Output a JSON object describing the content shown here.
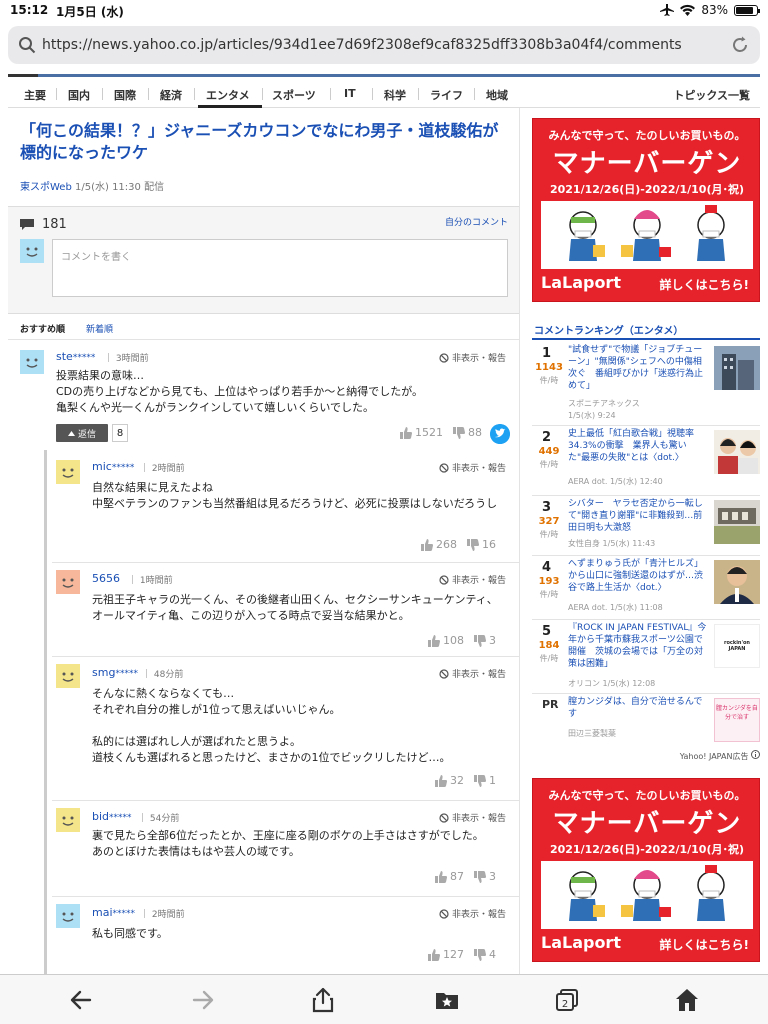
{
  "status": {
    "time": "15:12",
    "date": "1月5日 (水)",
    "battery_text": "83%",
    "battery_level": 0.83
  },
  "browser": {
    "url": "https://news.yahoo.co.jp/articles/934d1ee7d69f2308ef9caf8325dff3308b3a04f4/comments"
  },
  "nav": {
    "tabs": [
      "主要",
      "国内",
      "国際",
      "経済",
      "エンタメ",
      "スポーツ",
      "IT",
      "科学",
      "ライフ",
      "地域"
    ],
    "active": "エンタメ",
    "topics": "トピックス一覧"
  },
  "article": {
    "title": "「何この結果！？」ジャニーズカウコンでなにわ男子・道枝駿佑が標的になったワケ",
    "source": "東スポWeb",
    "datetime": "1/5(水) 11:30 配信"
  },
  "comment_area": {
    "count": "181",
    "own_comments": "自分のコメント",
    "placeholder": "コメントを書く",
    "sort_recommended": "おすすめ順",
    "sort_new": "新着順"
  },
  "comments": [
    {
      "user": "ste",
      "stars": "*****",
      "time": "3時間前",
      "report": "非表示・報告",
      "text": "投票結果の意味…\nCDの売り上げなどから見ても、上位はやっぱり若手か〜と納得でしたが。\n亀梨くんや光一くんがランクインしていて嬉しいくらいでした。",
      "likes": "1521",
      "dislikes": "88",
      "reply_label": "返信",
      "reply_count": "8"
    }
  ],
  "replies": [
    {
      "user": "mic",
      "stars": "*****",
      "time": "2時間前",
      "report": "非表示・報告",
      "text": "自然な結果に見えたよね\n中堅ベテランのファンも当然番組は見るだろうけど、必死に投票はしないだろうし",
      "likes": "268",
      "dislikes": "16"
    },
    {
      "user": "5656",
      "stars": "",
      "time": "1時間前",
      "report": "非表示・報告",
      "text": "元祖王子キャラの光一くん、その後継者山田くん、セクシーサンキューケンティ、オールマイティ亀、この辺りが入ってる時点で妥当な結果かと。",
      "likes": "108",
      "dislikes": "3"
    },
    {
      "user": "smg",
      "stars": "*****",
      "time": "48分前",
      "report": "非表示・報告",
      "text": "そんなに熱くならなくても…\nそれぞれ自分の推しが1位って思えばいいじゃん。\n\n私的には選ばれし人が選ばれたと思うよ。\n道枝くんも選ばれると思ったけど、まさかの1位でビックリしたけど…。",
      "likes": "32",
      "dislikes": "1"
    },
    {
      "user": "bid",
      "stars": "*****",
      "time": "54分前",
      "report": "非表示・報告",
      "text": "裏で見たら全部6位だったとか、王座に座る剛のボケの上手さはさすがでした。\nあのとぼけた表情はもはや芸人の域です。",
      "likes": "87",
      "dislikes": "3"
    },
    {
      "user": "mai",
      "stars": "*****",
      "time": "2時間前",
      "report": "非表示・報告",
      "text": "私も同感です。",
      "likes": "127",
      "dislikes": "4"
    }
  ],
  "ads": {
    "line1": "みんなで守って、たのしいお買いもの。",
    "line2": "マナーバーゲン",
    "line3": "2021/12/26(日)-2022/1/10(月･祝)",
    "brand": "LaLaport",
    "cta": "詳しくはこちら!"
  },
  "ranking": {
    "title": "コメントランキング（エンタメ）",
    "unit": "件/時",
    "items": [
      {
        "rank": "1",
        "count": "1143",
        "text": "\"試食せず\"で物議「ジョブチューーン」\"無関係\"シェフへの中傷相次ぐ　番組呼びかけ「迷惑行為止めて」",
        "source": "スポニチアネックス",
        "time": "1/5(水) 9:24"
      },
      {
        "rank": "2",
        "count": "449",
        "text": "史上最低「紅白歌合戦」視聴率34.3%の衝撃　業界人も驚いた\"最悪の失敗\"とは〈dot.〉",
        "source": "AERA dot.",
        "time": "1/5(水) 12:40"
      },
      {
        "rank": "3",
        "count": "327",
        "text": "シバター　ヤラセ否定から一転して\"開き直り謝罪\"に非難殺到…前田日明も大激怒",
        "source": "女性自身",
        "time": "1/5(水) 11:43"
      },
      {
        "rank": "4",
        "count": "193",
        "text": "へずまりゅう氏が「青汁ヒルズ」から山口に強制送還のはずが…渋谷で路上生活か〈dot.〉",
        "source": "AERA dot.",
        "time": "1/5(水) 11:08"
      },
      {
        "rank": "5",
        "count": "184",
        "text": "『ROCK IN JAPAN FESTIVAL』今年から千葉市蘇我スポーツ公園で開催　茨城の会場では「万全の対策は困難」",
        "source": "オリコン",
        "time": "1/5(水) 12:08",
        "thumb": "rockin'on JAPAN"
      }
    ],
    "pr": {
      "label": "PR",
      "text": "膣カンジダは、自分で治せるんです",
      "sponsor": "田辺三菱製薬",
      "thumb": "膣カンジダを自分で治す"
    },
    "credit": "Yahoo! JAPAN広告"
  }
}
